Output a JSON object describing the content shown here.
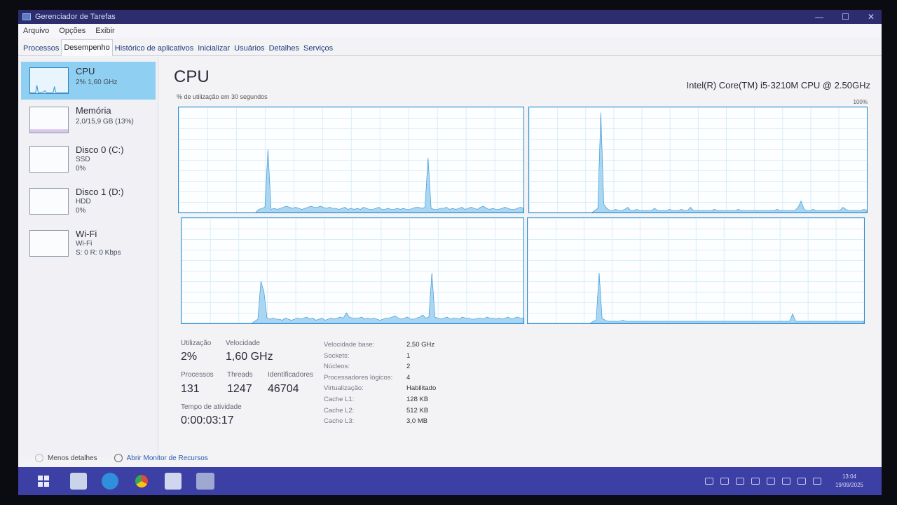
{
  "window": {
    "title": "Gerenciador de Tarefas",
    "controls": [
      "—",
      "☐",
      "✕"
    ]
  },
  "menu": [
    "Arquivo",
    "Opções",
    "Exibir"
  ],
  "tabs": [
    {
      "label": "Processos",
      "active": false
    },
    {
      "label": "Desempenho",
      "active": true
    },
    {
      "label": "Histórico de aplicativos",
      "active": false
    },
    {
      "label": "Inicializar",
      "active": false
    },
    {
      "label": "Usuários",
      "active": false
    },
    {
      "label": "Detalhes",
      "active": false
    },
    {
      "label": "Serviços",
      "active": false
    }
  ],
  "sidebar": [
    {
      "title": "CPU",
      "sub1": "2%  1,60 GHz",
      "sub2": "",
      "selected": true
    },
    {
      "title": "Memória",
      "sub1": "2,0/15,9 GB (13%)",
      "sub2": "",
      "selected": false
    },
    {
      "title": "Disco 0 (C:)",
      "sub1": "SSD",
      "sub2": "0%",
      "selected": false
    },
    {
      "title": "Disco 1 (D:)",
      "sub1": "HDD",
      "sub2": "0%",
      "selected": false
    },
    {
      "title": "Wi-Fi",
      "sub1": "Wi-Fi",
      "sub2": "S: 0 R: 0 Kbps",
      "selected": false
    }
  ],
  "main": {
    "title": "CPU",
    "model": "Intel(R) Core(TM) i5-3210M CPU @ 2.50GHz",
    "util_label": "% de utilização em 30 segundos",
    "max_label": "100%"
  },
  "cores": [
    [
      0,
      0,
      0,
      0,
      0,
      0,
      0,
      0,
      0,
      0,
      0,
      0,
      0,
      0,
      0,
      0,
      0,
      0,
      0,
      0,
      0,
      0,
      0,
      0,
      0,
      0,
      3,
      4,
      5,
      60,
      3,
      4,
      3,
      4,
      5,
      6,
      5,
      4,
      5,
      4,
      3,
      4,
      5,
      6,
      5,
      5,
      6,
      5,
      4,
      5,
      4,
      4,
      3,
      4,
      5,
      3,
      4,
      3,
      4,
      3,
      5,
      4,
      3,
      3,
      4,
      5,
      3,
      3,
      4,
      3,
      3,
      4,
      3,
      4,
      3,
      3,
      4,
      5,
      5,
      4,
      5,
      52,
      4,
      3,
      3,
      4,
      4,
      5,
      3,
      4,
      3,
      4,
      5,
      3,
      4,
      5,
      4,
      3,
      5,
      6,
      4,
      3,
      4,
      3,
      3,
      4,
      5,
      4,
      3,
      3,
      4,
      5,
      4
    ],
    [
      0,
      0,
      0,
      0,
      0,
      0,
      0,
      0,
      0,
      0,
      0,
      0,
      0,
      0,
      0,
      0,
      0,
      0,
      0,
      0,
      0,
      0,
      2,
      4,
      95,
      8,
      4,
      2,
      2,
      3,
      2,
      2,
      3,
      5,
      2,
      2,
      3,
      2,
      2,
      2,
      2,
      2,
      4,
      2,
      2,
      2,
      2,
      3,
      2,
      2,
      2,
      3,
      2,
      2,
      5,
      2,
      2,
      2,
      2,
      2,
      2,
      2,
      3,
      2,
      2,
      2,
      2,
      2,
      2,
      2,
      3,
      2,
      2,
      2,
      2,
      2,
      2,
      2,
      2,
      2,
      2,
      2,
      2,
      3,
      2,
      2,
      2,
      2,
      2,
      2,
      5,
      11,
      3,
      2,
      2,
      3,
      2,
      2,
      2,
      2,
      2,
      2,
      2,
      2,
      2,
      5,
      3,
      2,
      2,
      2,
      2,
      2,
      3,
      2
    ],
    [
      0,
      0,
      0,
      0,
      0,
      0,
      0,
      0,
      0,
      0,
      0,
      0,
      0,
      0,
      0,
      0,
      0,
      0,
      0,
      0,
      0,
      0,
      0,
      0,
      2,
      4,
      40,
      30,
      5,
      4,
      5,
      4,
      4,
      3,
      5,
      4,
      3,
      4,
      5,
      4,
      5,
      6,
      4,
      5,
      3,
      4,
      5,
      3,
      4,
      5,
      4,
      5,
      6,
      5,
      10,
      6,
      5,
      5,
      5,
      6,
      4,
      5,
      4,
      5,
      4,
      3,
      4,
      5,
      5,
      6,
      7,
      5,
      4,
      5,
      6,
      4,
      4,
      5,
      6,
      8,
      5,
      6,
      48,
      6,
      5,
      4,
      5,
      6,
      4,
      5,
      5,
      4,
      6,
      5,
      5,
      4,
      4,
      5,
      5,
      4,
      6,
      5,
      5,
      4,
      5,
      4,
      5,
      6,
      4,
      5,
      6,
      5,
      5
    ],
    [
      0,
      0,
      0,
      0,
      0,
      0,
      0,
      0,
      0,
      0,
      0,
      0,
      0,
      0,
      0,
      0,
      0,
      0,
      0,
      0,
      0,
      0,
      2,
      3,
      48,
      5,
      3,
      2,
      2,
      2,
      2,
      2,
      3,
      2,
      2,
      2,
      2,
      2,
      2,
      2,
      2,
      2,
      2,
      2,
      2,
      2,
      2,
      2,
      2,
      2,
      2,
      2,
      2,
      2,
      2,
      2,
      2,
      2,
      2,
      2,
      2,
      2,
      2,
      2,
      2,
      2,
      2,
      2,
      2,
      2,
      2,
      2,
      2,
      2,
      2,
      2,
      2,
      2,
      2,
      2,
      2,
      2,
      2,
      2,
      2,
      2,
      2,
      2,
      2,
      9,
      2,
      2,
      2,
      2,
      2,
      2,
      2,
      2,
      2,
      2,
      2,
      2,
      2,
      2,
      2,
      2,
      2,
      2,
      2,
      2,
      2,
      2,
      2,
      2
    ]
  ],
  "stats": {
    "utilizacao_label": "Utilização",
    "utilizacao": "2%",
    "velocidade_label": "Velocidade",
    "velocidade": "1,60 GHz",
    "processos_label": "Processos",
    "processos": "131",
    "threads_label": "Threads",
    "threads": "1247",
    "identificadores_label": "Identificadores",
    "identificadores": "46704",
    "tempo_label": "Tempo de atividade",
    "tempo": "0:00:03:17"
  },
  "specs": [
    {
      "k": "Velocidade base:",
      "v": "2,50 GHz"
    },
    {
      "k": "Sockets:",
      "v": "1"
    },
    {
      "k": "Núcleos:",
      "v": "2"
    },
    {
      "k": "Processadores lógicos:",
      "v": "4"
    },
    {
      "k": "Virtualização:",
      "v": "Habilitado"
    },
    {
      "k": "Cache L1:",
      "v": "128 KB"
    },
    {
      "k": "Cache L2:",
      "v": "512 KB"
    },
    {
      "k": "Cache L3:",
      "v": "3,0 MB"
    }
  ],
  "footer": {
    "less_details": "Menos detalhes",
    "resource_monitor": "Abrir Monitor de Recursos"
  },
  "taskbar": {
    "icons": [
      "windows-icon",
      "file-explorer-icon",
      "edge-icon",
      "chrome-icon",
      "store-icon",
      "task-manager-icon"
    ],
    "clock_time": "13:04",
    "clock_date": "19/09/2025"
  },
  "colors": {
    "graph_line": "#2d8ed0",
    "graph_fill": "#a9d6f2",
    "selected": "#8fd0f2",
    "taskbar": "#3c3fa3"
  }
}
